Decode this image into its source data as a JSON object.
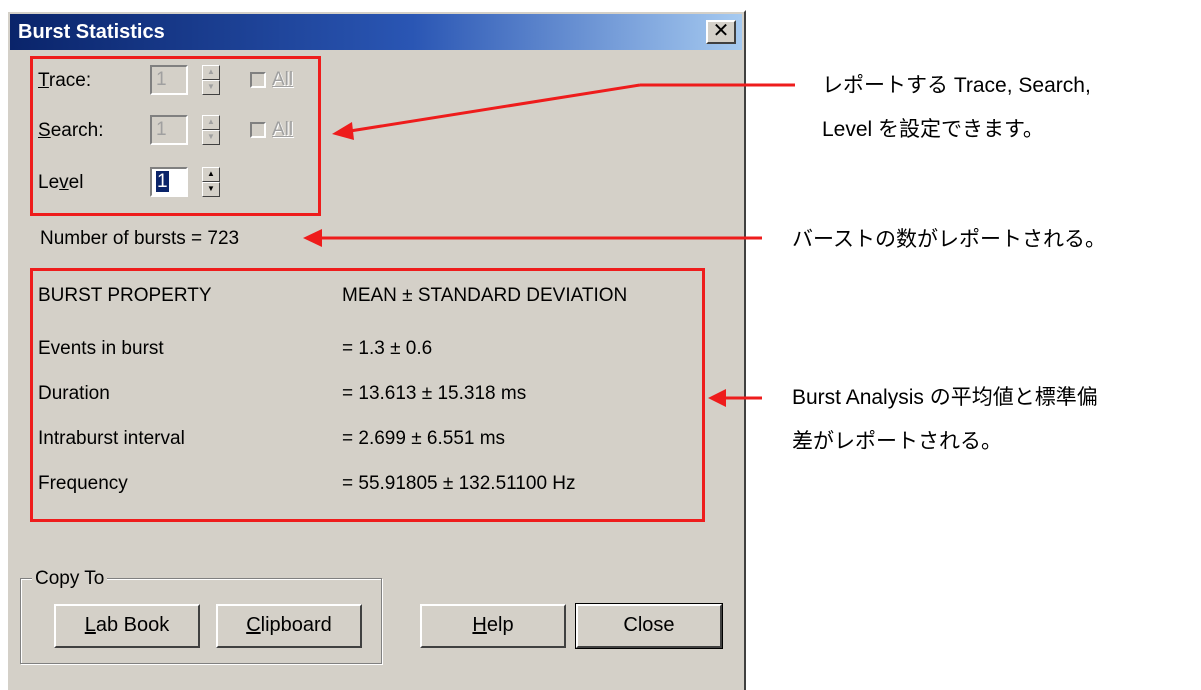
{
  "window": {
    "title": "Burst Statistics",
    "close_glyph": "✕"
  },
  "selectors": {
    "trace": {
      "label_first": "T",
      "label_rest": "race:",
      "value": "1",
      "all_label": "All"
    },
    "search": {
      "label_first": "S",
      "label_rest": "earch:",
      "value": "1",
      "all_label": "All"
    },
    "level": {
      "label_a": "Le",
      "label_u": "v",
      "label_b": "el",
      "value": "1"
    }
  },
  "burst_count": "Number of bursts = 723",
  "stats": {
    "header_property": "BURST PROPERTY",
    "header_value": "MEAN ± STANDARD DEVIATION",
    "rows": [
      {
        "property": "Events in burst",
        "value": "=  1.3 ± 0.6"
      },
      {
        "property": "Duration",
        "value": "=  13.613 ± 15.318 ms"
      },
      {
        "property": "Intraburst interval",
        "value": "=  2.699 ± 6.551 ms"
      },
      {
        "property": "Frequency",
        "value": "=  55.91805 ± 132.51100 Hz"
      }
    ]
  },
  "copy_to": {
    "legend": "Copy To",
    "lab_book": {
      "u": "L",
      "rest": "ab Book"
    },
    "clipboard": {
      "u": "C",
      "rest": "lipboard"
    }
  },
  "buttons": {
    "help": {
      "u": "H",
      "rest": "elp"
    },
    "close": "Close"
  },
  "annotations": {
    "note1_line1": "レポートする Trace, Search,",
    "note1_line2": "Level を設定できます。",
    "note2": "バーストの数がレポートされる。",
    "note3_line1": "Burst Analysis の平均値と標準偏",
    "note3_line2": "差がレポートされる。"
  },
  "colors": {
    "annotation_red": "#ee1c1c",
    "dialog_face": "#d4d0c8",
    "title_blue": "#0a246a"
  }
}
